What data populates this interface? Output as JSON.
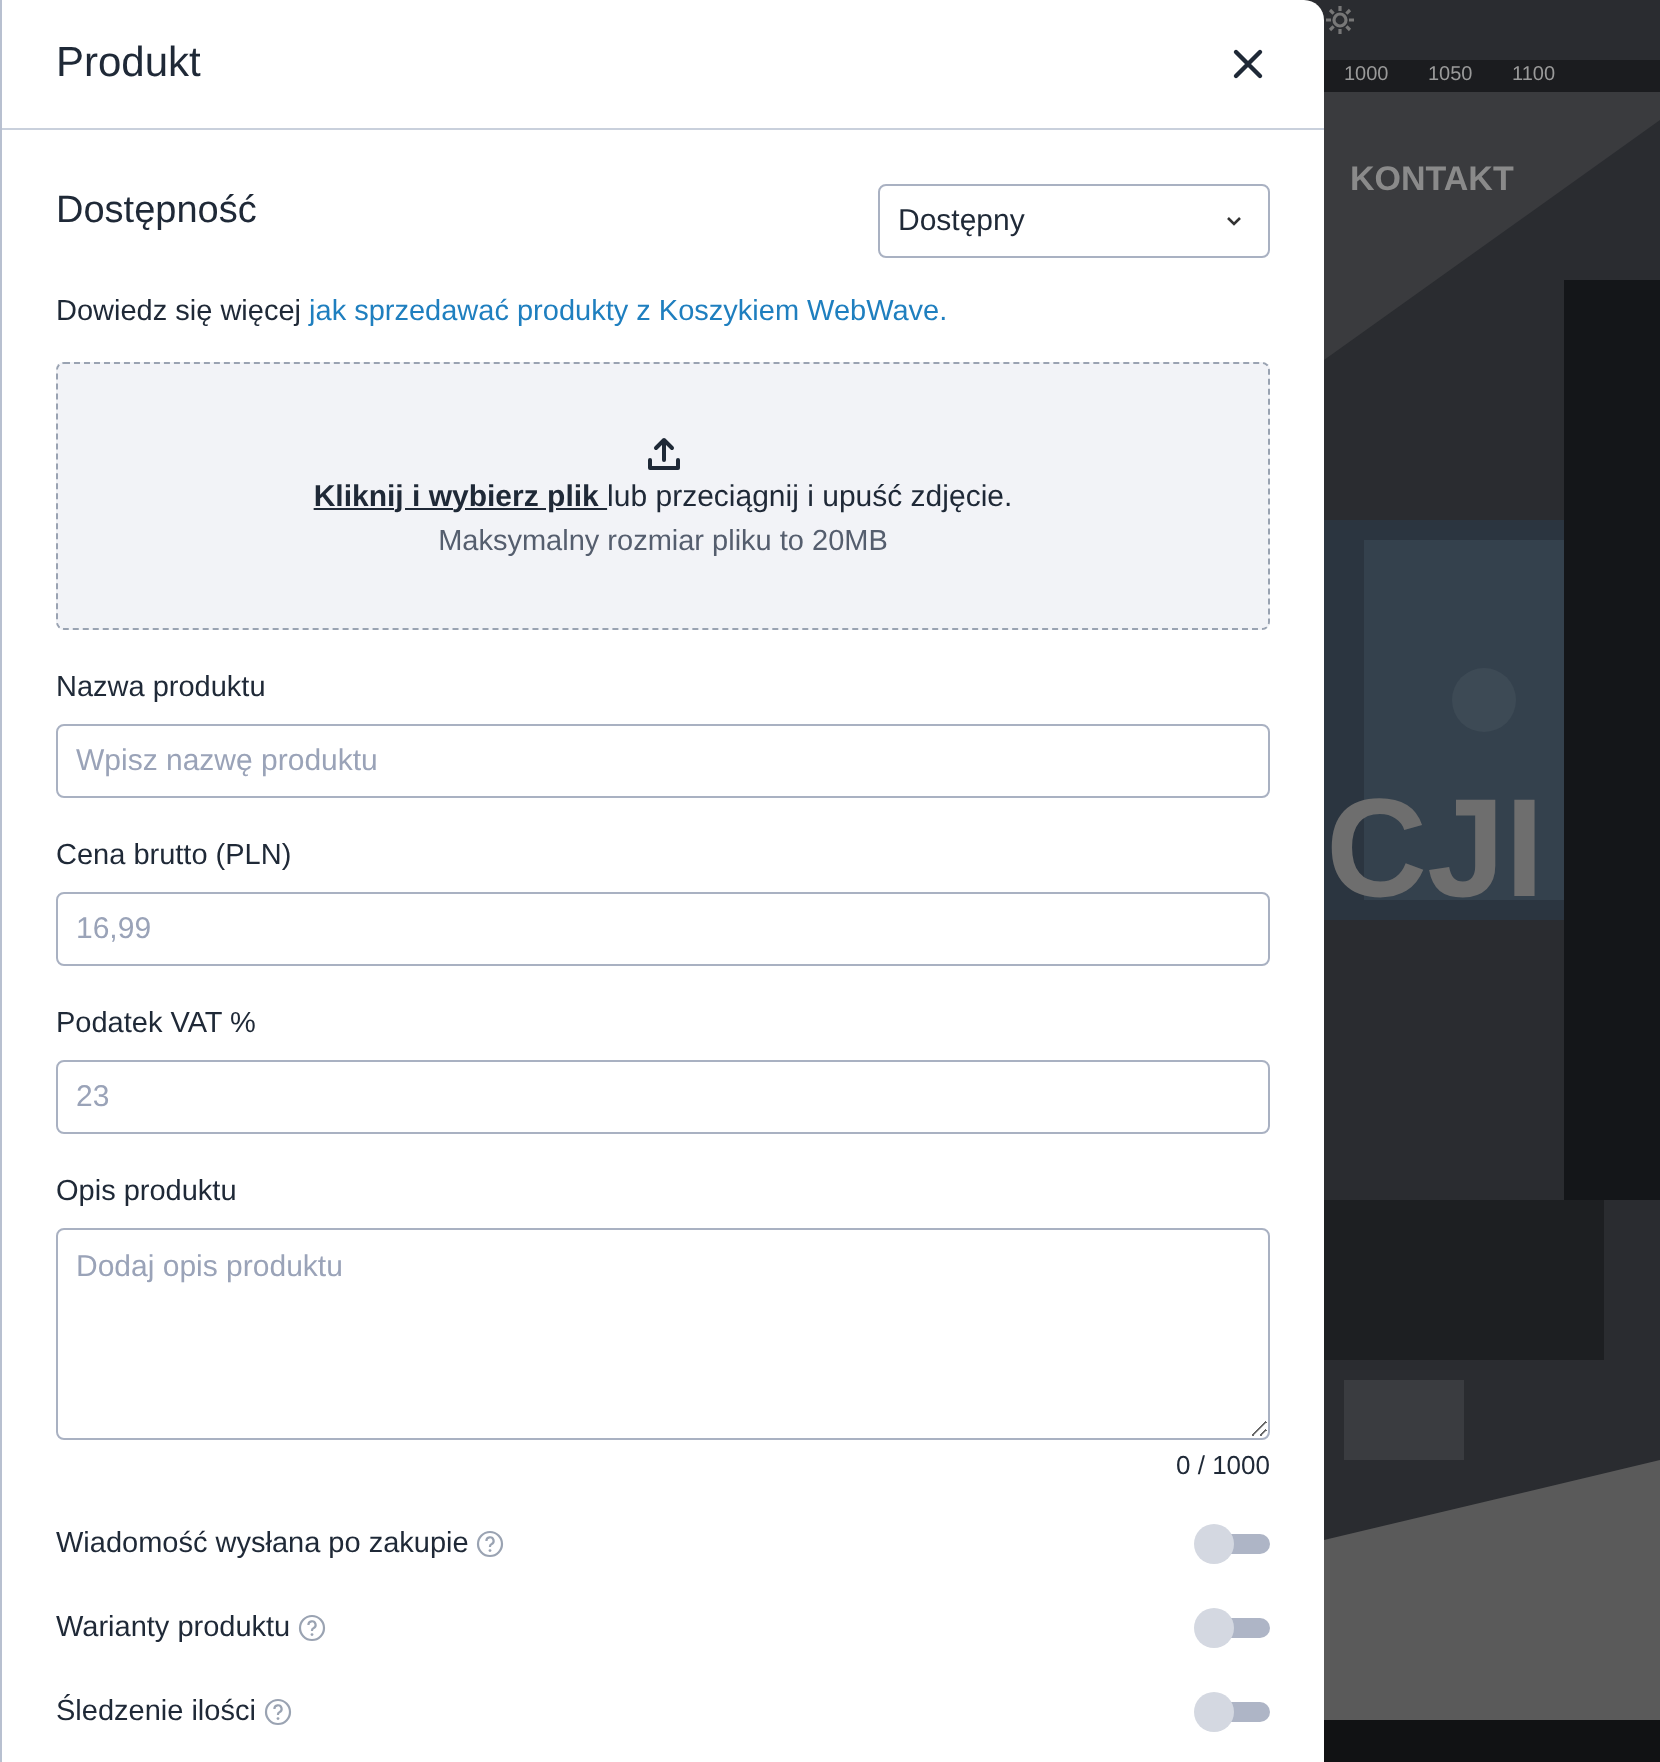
{
  "editor_backdrop": {
    "ruler_ticks": [
      "1000",
      "1050",
      "1100"
    ],
    "nav_item": "KONTAKT",
    "heading_fragment": "CJI"
  },
  "dialog": {
    "title": "Produkt",
    "availability": {
      "label": "Dostępność",
      "value": "Dostępny"
    },
    "info": {
      "text": "Dowiedz się więcej ",
      "link": "jak sprzedawać produkty z Koszykiem WebWave."
    },
    "upload": {
      "link": "Kliknij i wybierz plik ",
      "text": "lub przeciągnij i upuść zdjęcie.",
      "hint": "Maksymalny rozmiar pliku to 20MB"
    },
    "fields": [
      {
        "kind": "input",
        "label": "Nazwa produktu",
        "placeholder": "Wpisz nazwę produktu"
      },
      {
        "kind": "input",
        "label": "Cena brutto (PLN)",
        "placeholder": "16,99"
      },
      {
        "kind": "input",
        "label": "Podatek VAT %",
        "placeholder": "23"
      },
      {
        "kind": "textarea",
        "label": "Opis produktu",
        "placeholder": "Dodaj opis produktu",
        "counter": "0 / 1000"
      }
    ],
    "toggles": [
      {
        "label": "Wiadomość wysłana po zakupie",
        "on": false
      },
      {
        "label": "Warianty produktu",
        "on": false
      },
      {
        "label": "Śledzenie ilości",
        "on": false
      }
    ]
  }
}
